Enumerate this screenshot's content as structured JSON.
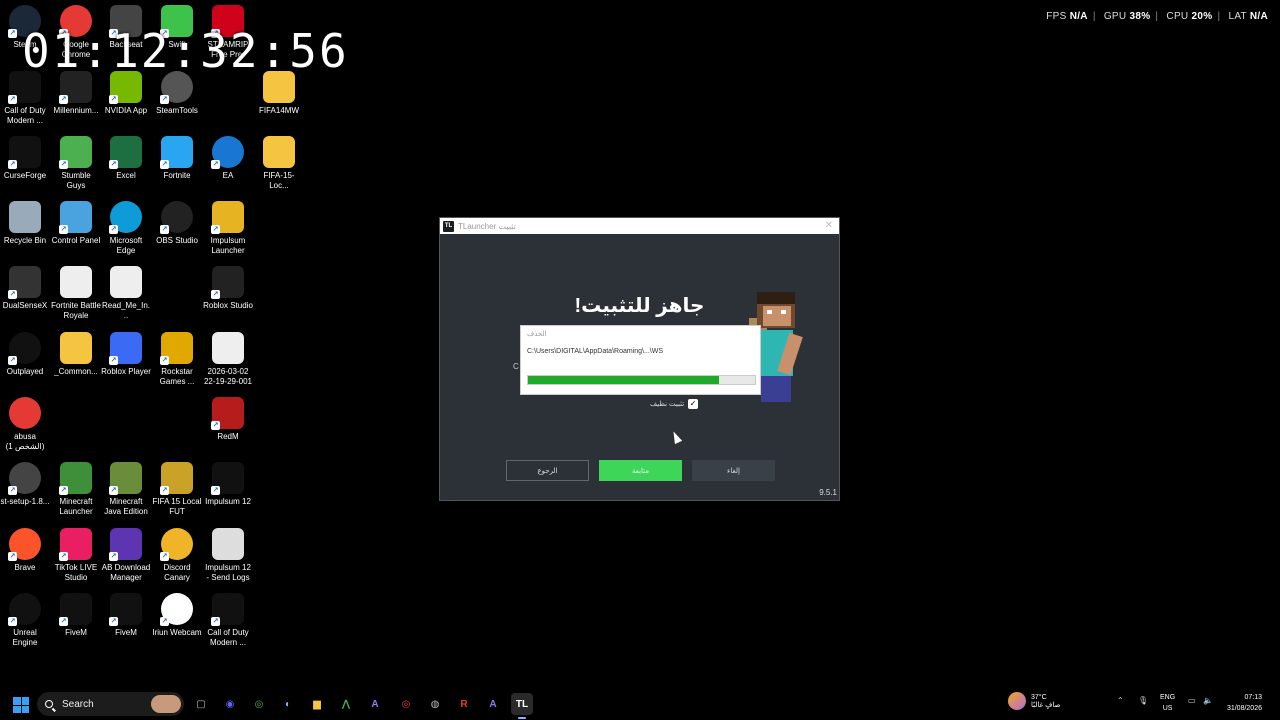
{
  "overlay": {
    "clock": "01:12:32:56",
    "perf": {
      "fps_label": "FPS",
      "fps_value": "N/A",
      "gpu_label": "GPU",
      "gpu_value": "38%",
      "cpu_label": "CPU",
      "cpu_value": "20%",
      "lat_label": "LAT",
      "lat_value": "N/A"
    }
  },
  "desktop_icons": [
    {
      "label": "Steam",
      "icon": "steam-icon",
      "color": "#1b2838"
    },
    {
      "label": "Google Chrome",
      "icon": "chrome-icon",
      "color": "#e53935"
    },
    {
      "label": "Backseat",
      "icon": "bm-icon",
      "color": "#444"
    },
    {
      "label": "Swift",
      "icon": "swift-icon",
      "color": "#3dc34b"
    },
    {
      "label": "STEAMRIP Free Pre-ins...",
      "icon": "opera-icon",
      "color": "#d0021b"
    },
    {
      "label": "Call of Duty Modern ...",
      "icon": "cod-icon",
      "color": "#111"
    },
    {
      "label": "Millennium...",
      "icon": "millennium-icon",
      "color": "#222"
    },
    {
      "label": "NVIDIA App",
      "icon": "nvidia-icon",
      "color": "#76b900"
    },
    {
      "label": "SteamTools",
      "icon": "steamtools-icon",
      "color": "#555"
    },
    {
      "label": "FIFA14MW",
      "icon": "folder-icon",
      "color": "#f5c542"
    },
    {
      "label": "CurseForge",
      "icon": "curseforge-icon",
      "color": "#111"
    },
    {
      "label": "Stumble Guys",
      "icon": "stumble-icon",
      "color": "#4caf50"
    },
    {
      "label": "Excel",
      "icon": "excel-icon",
      "color": "#1d6f42"
    },
    {
      "label": "Fortnite",
      "icon": "fortnite-icon",
      "color": "#29a5f2"
    },
    {
      "label": "EA",
      "icon": "ea-icon",
      "color": "#1976d2"
    },
    {
      "label": "FIFA-15-Loc...",
      "icon": "folder-icon",
      "color": "#f5c542"
    },
    {
      "label": "Recycle Bin",
      "icon": "recycle-bin-icon",
      "color": "#9ab"
    },
    {
      "label": "Control Panel",
      "icon": "control-panel-icon",
      "color": "#4aa3df"
    },
    {
      "label": "Microsoft Edge",
      "icon": "edge-icon",
      "color": "#0f9bd7"
    },
    {
      "label": "OBS Studio",
      "icon": "obs-icon",
      "color": "#222"
    },
    {
      "label": "Impulsum Launcher",
      "icon": "impulsum-icon",
      "color": "#e6b422"
    },
    {
      "label": "DualSenseX",
      "icon": "dualsensex-icon",
      "color": "#333"
    },
    {
      "label": "Fortnite Battle Royale",
      "icon": "file-icon",
      "color": "#eee"
    },
    {
      "label": "Read_Me_In...",
      "icon": "file-icon",
      "color": "#eee"
    },
    {
      "label": "Roblox Studio",
      "icon": "roblox-studio-icon",
      "color": "#222"
    },
    {
      "label": "Outplayed",
      "icon": "outplayed-icon",
      "color": "#111"
    },
    {
      "label": "_Common...",
      "icon": "folder-icon",
      "color": "#f5c542"
    },
    {
      "label": "Roblox Player",
      "icon": "roblox-icon",
      "color": "#3b6bf5"
    },
    {
      "label": "Rockstar Games ...",
      "icon": "rockstar-icon",
      "color": "#e0a800"
    },
    {
      "label": "2026-03-02 22-19-29-001",
      "icon": "video-file-icon",
      "color": "#eee"
    },
    {
      "label": "abusa (الشخص 1)",
      "icon": "chrome-profile-icon",
      "color": "#e53935"
    },
    {
      "label": "RedM",
      "icon": "redm-icon",
      "color": "#b71c1c"
    },
    {
      "label": "st-setup-1.8...",
      "icon": "steam-setup-icon",
      "color": "#444"
    },
    {
      "label": "Minecraft Launcher",
      "icon": "minecraft-launcher-icon",
      "color": "#3f8e3a"
    },
    {
      "label": "Minecraft Java Edition",
      "icon": "minecraft-java-icon",
      "color": "#6a8d3b"
    },
    {
      "label": "FIFA 15 Local FUT",
      "icon": "fifa15-icon",
      "color": "#c9a227"
    },
    {
      "label": "Impulsum 12",
      "icon": "impulsum12-icon",
      "color": "#111"
    },
    {
      "label": "Brave",
      "icon": "brave-icon",
      "color": "#fb542b"
    },
    {
      "label": "TikTok LIVE Studio",
      "icon": "tiktok-icon",
      "color": "#e91e63"
    },
    {
      "label": "AB Download Manager",
      "icon": "ab-download-icon",
      "color": "#5e35b1"
    },
    {
      "label": "Discord Canary",
      "icon": "discord-canary-icon",
      "color": "#f0b429"
    },
    {
      "label": "Impulsum 12 - Send Logs",
      "icon": "settings-file-icon",
      "color": "#ddd"
    },
    {
      "label": "Unreal Engine",
      "icon": "unreal-icon",
      "color": "#111"
    },
    {
      "label": "FiveM",
      "icon": "fivem-icon",
      "color": "#111"
    },
    {
      "label": "FiveM",
      "icon": "fivem-icon",
      "color": "#111"
    },
    {
      "label": "Iriun Webcam",
      "icon": "iriun-icon",
      "color": "#fff"
    },
    {
      "label": "Call of Duty Modern ...",
      "icon": "cod-mw3-icon",
      "color": "#111"
    }
  ],
  "installer": {
    "window_title": "TLauncher تثبيت",
    "logo_text": "TL",
    "heading": "جاهز للتثبيت!",
    "progress_dialog_title": "الحذف",
    "progress_path": "C:\\Users\\DIGITAL\\AppData\\Roaming\\...\\WS",
    "progress_value": 0.84,
    "side_char": "C",
    "checkbox_label": "تثبيت نظيف",
    "checkbox_checked": true,
    "back_button": "الرجوع",
    "next_button": "متابعة",
    "cancel_button": "إلغاء",
    "version": "9.5.1"
  },
  "taskbar": {
    "search_placeholder": "Search",
    "apps": [
      {
        "name": "task-view-icon",
        "glyph": "▢",
        "color": "#bbb"
      },
      {
        "name": "discord-icon",
        "glyph": "◉",
        "color": "#5865f2"
      },
      {
        "name": "chrome-taskbar-icon",
        "glyph": "◎",
        "color": "#4caf50"
      },
      {
        "name": "steam-taskbar-icon",
        "glyph": "◐",
        "color": "#66c0f4"
      },
      {
        "name": "file-explorer-icon",
        "glyph": "▆",
        "color": "#f5c542"
      },
      {
        "name": "fivem-taskbar-icon",
        "glyph": "⋀",
        "color": "#4caf50"
      },
      {
        "name": "arc-icon",
        "glyph": "A",
        "color": "#8e7cf0"
      },
      {
        "name": "chrome-profile-taskbar-icon",
        "glyph": "◎",
        "color": "#e53935"
      },
      {
        "name": "steam-setup-taskbar-icon",
        "glyph": "◍",
        "color": "#bbb"
      },
      {
        "name": "redm-taskbar-icon",
        "glyph": "R",
        "color": "#e53935"
      },
      {
        "name": "arc2-icon",
        "glyph": "A",
        "color": "#8e7cf0"
      },
      {
        "name": "tlauncher-taskbar-icon",
        "glyph": "TL",
        "color": "#fff"
      }
    ],
    "weather_temp": "37°C",
    "weather_desc": "صافٍ غالبًا",
    "lang_primary": "ENG",
    "lang_secondary": "US",
    "time": "07:13",
    "date": "31/08/2026"
  }
}
